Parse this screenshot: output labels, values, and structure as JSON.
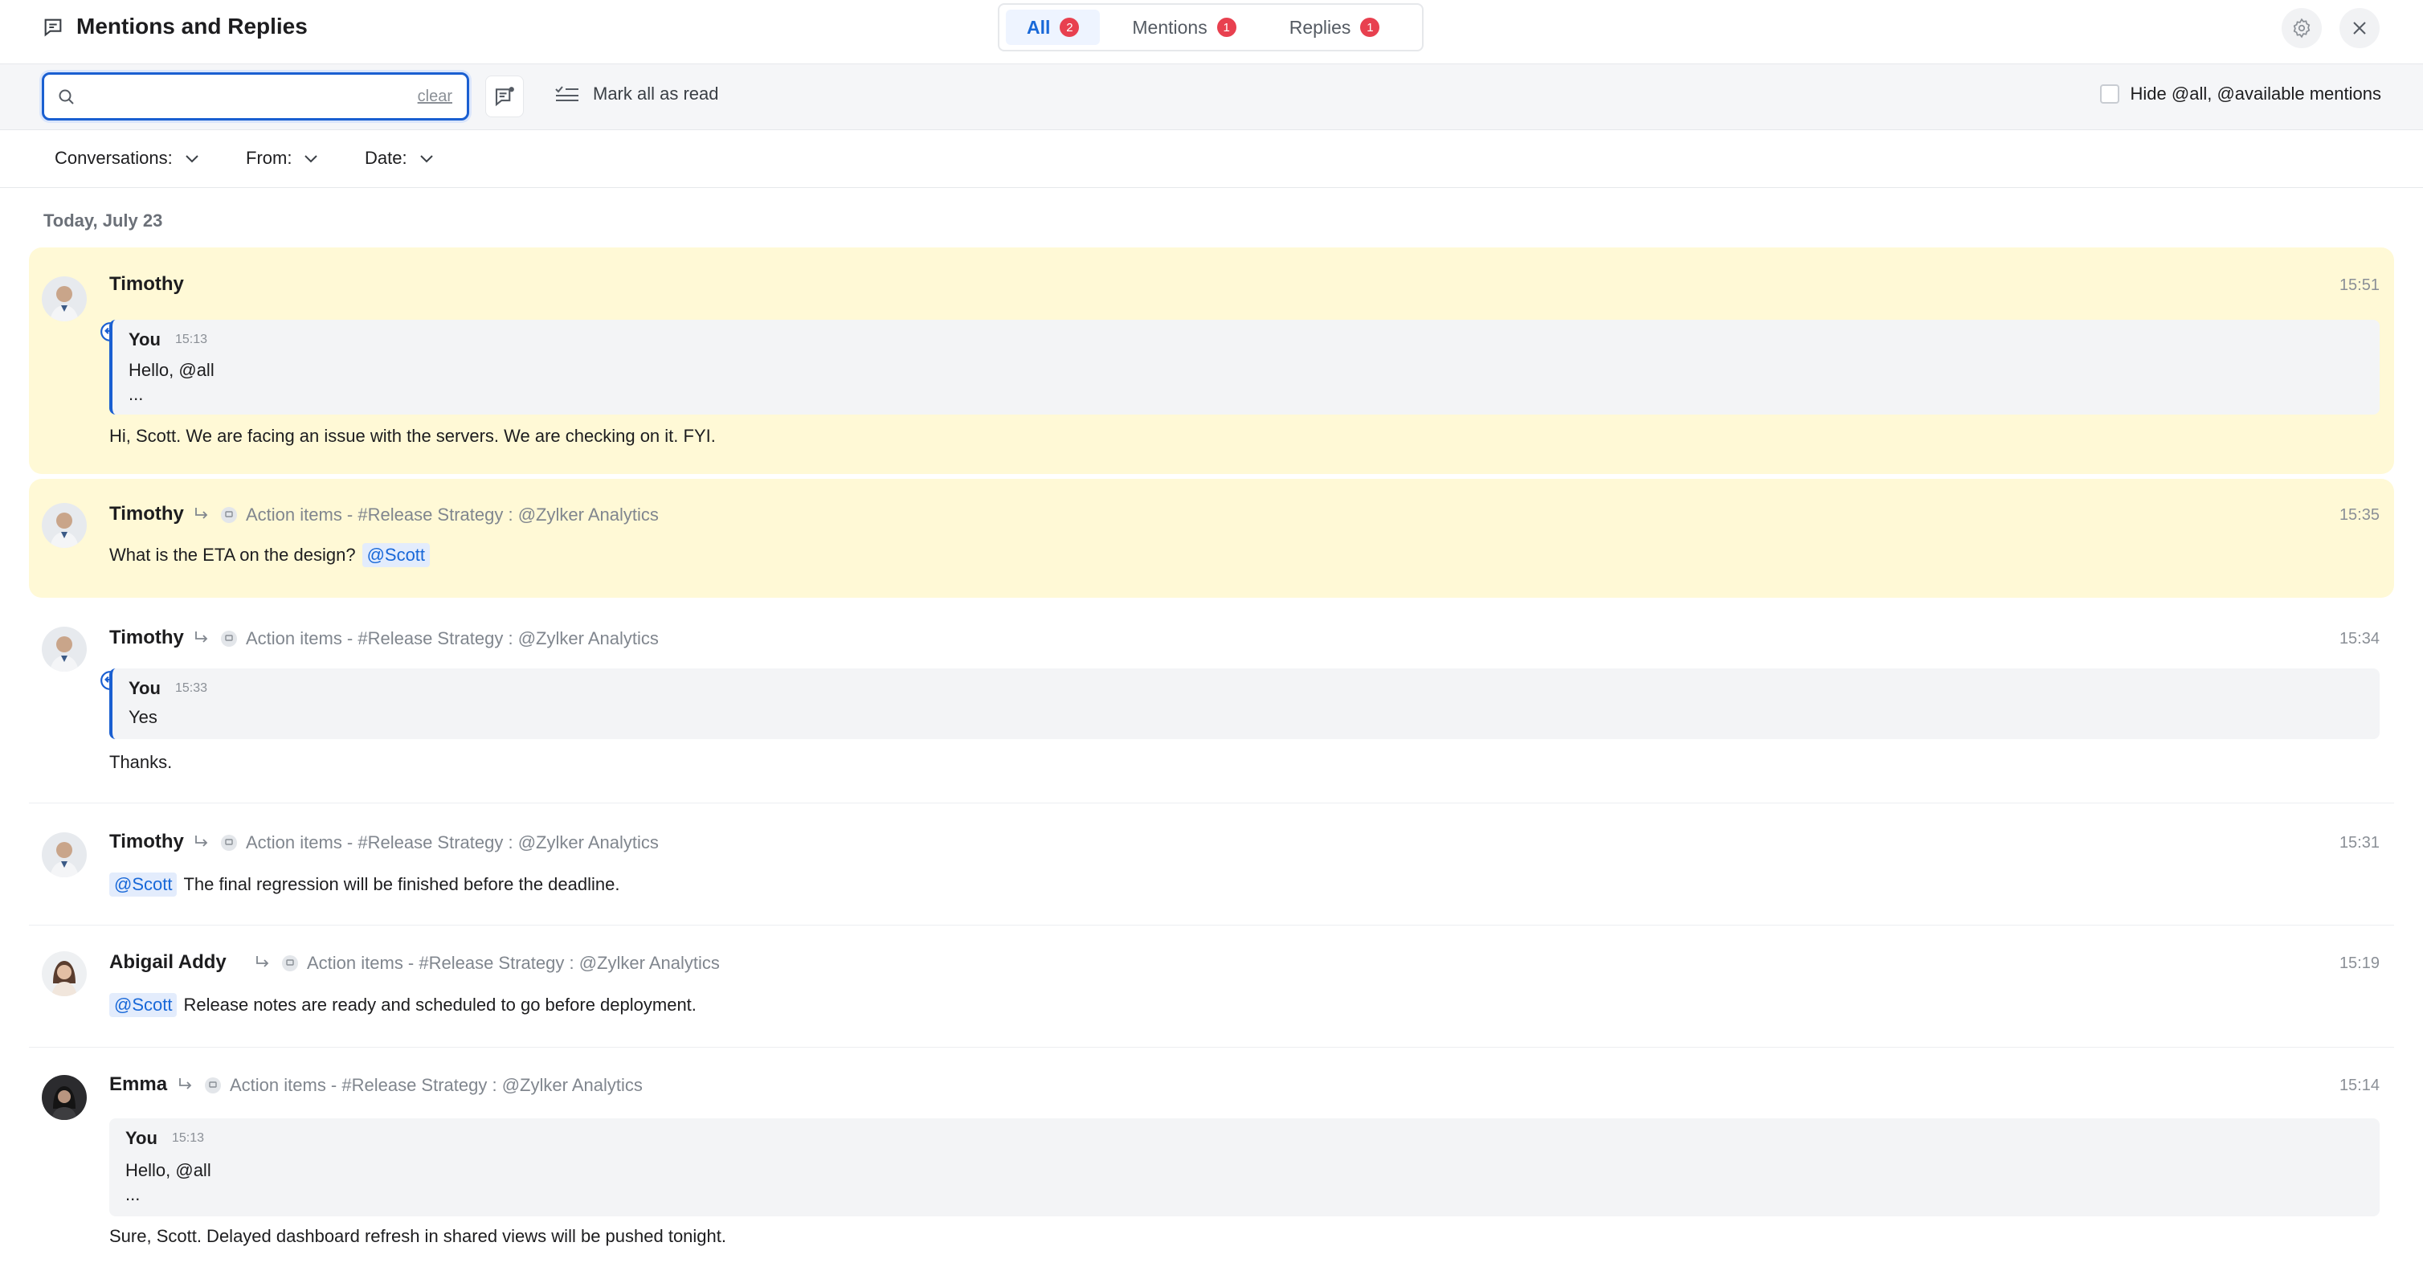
{
  "header": {
    "title": "Mentions and Replies",
    "tabs": [
      {
        "label": "All",
        "count": "2"
      },
      {
        "label": "Mentions",
        "count": "1"
      },
      {
        "label": "Replies",
        "count": "1"
      }
    ]
  },
  "toolbar": {
    "search_value": "",
    "search_placeholder": "",
    "clear_label": "clear",
    "mark_all_read": "Mark all as read",
    "hide_label": "Hide @all, @available mentions"
  },
  "filters": {
    "conversations": "Conversations:",
    "from": "From:",
    "date": "Date:"
  },
  "date_group": "Today, July 23",
  "messages": [
    {
      "sender": "Timothy",
      "time": "15:51",
      "quote": {
        "author": "You",
        "time": "15:13",
        "line1": "Hello, @all",
        "line2": "..."
      },
      "text": "Hi, Scott. We are facing an issue with the servers. We are checking on it. FYI."
    },
    {
      "sender": "Timothy",
      "time": "15:35",
      "channel": "Action items - #Release Strategy : @Zylker Analytics",
      "text": "What is the ETA on the design?",
      "mention": "@Scott"
    },
    {
      "sender": "Timothy",
      "time": "15:34",
      "channel": "Action items - #Release Strategy : @Zylker Analytics",
      "quote": {
        "author": "You",
        "time": "15:33",
        "line1": "Yes"
      },
      "text": "Thanks."
    },
    {
      "sender": "Timothy",
      "time": "15:31",
      "channel": "Action items - #Release Strategy : @Zylker Analytics",
      "mention": "@Scott",
      "text": "The final regression will be finished before the deadline."
    },
    {
      "sender": "Abigail Addy",
      "time": "15:19",
      "channel": "Action items - #Release Strategy : @Zylker Analytics",
      "mention": "@Scott",
      "text": "Release notes are ready and scheduled to go before deployment."
    },
    {
      "sender": "Emma",
      "time": "15:14",
      "channel": "Action items - #Release Strategy : @Zylker Analytics",
      "quote": {
        "author": "You",
        "time": "15:13",
        "line1": "Hello, @all",
        "line2": "..."
      },
      "text": "Sure, Scott. Delayed dashboard refresh in shared views will be pushed tonight."
    }
  ],
  "colors": {
    "accent": "#1a5fd1",
    "badge": "#e8404f",
    "highlight": "#fff9d6"
  }
}
